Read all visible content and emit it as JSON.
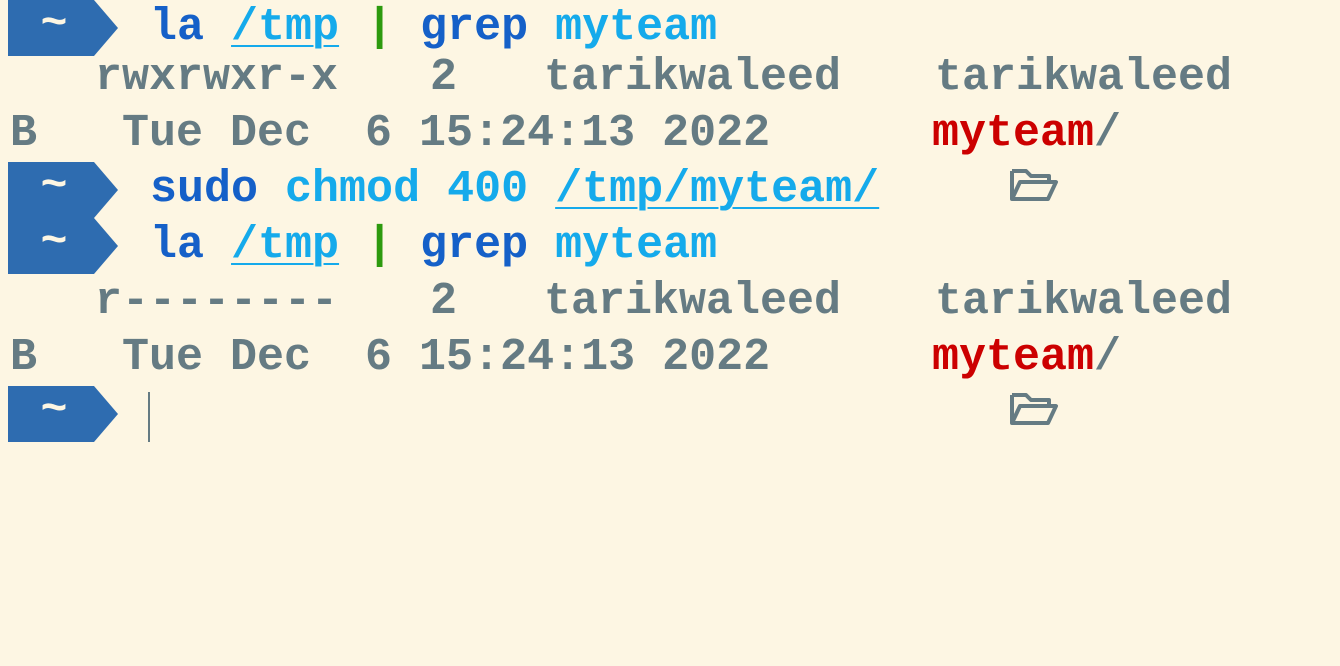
{
  "colors": {
    "background": "#fdf6e3",
    "prompt_bg": "#2e6cb0",
    "command": "#1560c8",
    "argument": "#15aaeb",
    "pipe": "#2d9a0e",
    "text": "#657b83",
    "dir_name": "#cc0000"
  },
  "prompt": {
    "dir": "~",
    "icon": "arrow-right-segment"
  },
  "commands": [
    {
      "program": "la",
      "path": "/tmp",
      "pipe": "|",
      "filter": "grep",
      "filter_arg": "myteam"
    },
    {
      "program": "sudo",
      "sub": "chmod",
      "mode": "400",
      "path": "/tmp/myteam/"
    },
    {
      "program": "la",
      "path": "/tmp",
      "pipe": "|",
      "filter": "grep",
      "filter_arg": "myteam"
    }
  ],
  "listings": [
    {
      "perms": "rwxrwxr-x",
      "links": "2",
      "owner": "tarikwaleed",
      "group": "tarikwaleed",
      "size": "B",
      "date": "Tue Dec  6 15:24:13 2022",
      "icon": "folder-open-icon",
      "name": "myteam",
      "suffix": "/"
    },
    {
      "perms": "r--------",
      "links": "2",
      "owner": "tarikwaleed",
      "group": "tarikwaleed",
      "size": "B",
      "date": "Tue Dec  6 15:24:13 2022",
      "icon": "folder-open-icon",
      "name": "myteam",
      "suffix": "/"
    }
  ]
}
